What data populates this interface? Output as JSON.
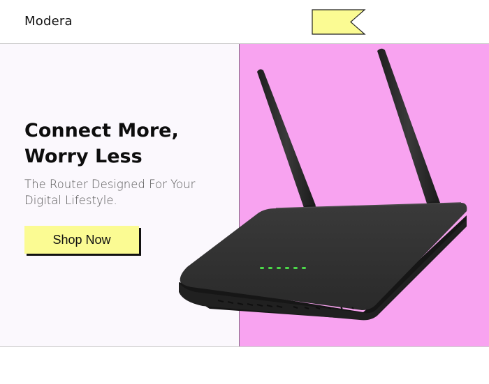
{
  "header": {
    "brand": "Modera",
    "flag_icon": "bookmark-flag-icon",
    "flag_color": "#fbfb93"
  },
  "hero": {
    "headline_line1": "Connect More,",
    "headline_line2": "Worry Less",
    "subhead_line1": "The Router Designed For Your",
    "subhead_line2": "Digital Lifestyle.",
    "cta_label": "Shop Now",
    "left_bg": "#fbf8fd",
    "right_bg": "#f8a3f0",
    "cta_color": "#fbfb93",
    "product_image": "wifi-router-image"
  }
}
